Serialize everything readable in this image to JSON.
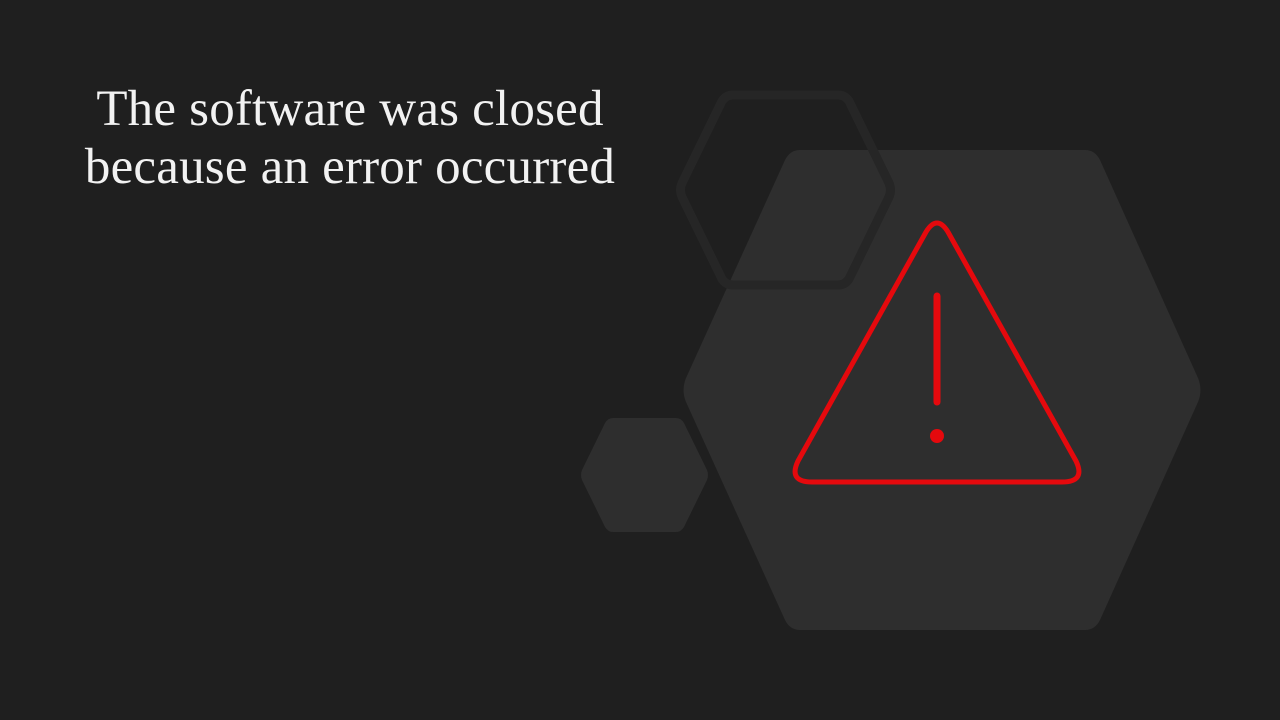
{
  "error_screen": {
    "message_line_1": "The software was closed",
    "message_line_2": "because an error occurred"
  },
  "icons": {
    "warning": "warning-triangle-icon"
  },
  "colors": {
    "background": "#1f1f1f",
    "hexagon_fill": "#2e2e2e",
    "hexagon_outline": "#262626",
    "warning": "#e5090d",
    "text": "#f2f2f2"
  }
}
